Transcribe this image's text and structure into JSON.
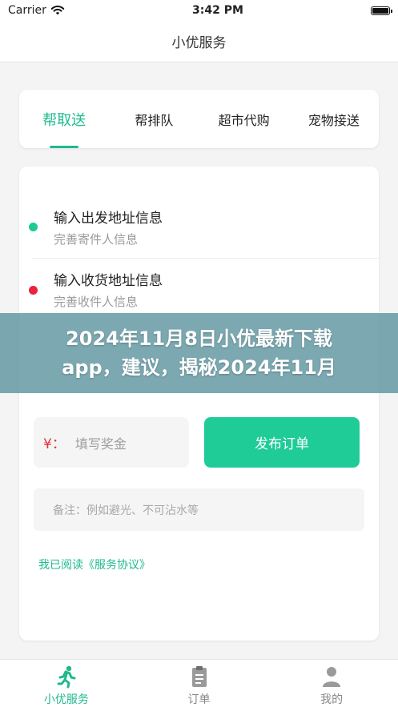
{
  "status_bar": {
    "carrier": "Carrier",
    "time": "3:42 PM"
  },
  "nav": {
    "title": "小优服务"
  },
  "service_tabs": [
    {
      "label": "帮取送",
      "active": true
    },
    {
      "label": "帮排队",
      "active": false
    },
    {
      "label": "超市代购",
      "active": false
    },
    {
      "label": "宠物接送",
      "active": false
    }
  ],
  "pickup": {
    "title": "输入出发地址信息",
    "subtitle": "完善寄件人信息",
    "dot_color": "#1fc996"
  },
  "delivery": {
    "title": "输入收货地址信息",
    "subtitle": "完善收件人信息",
    "dot_color": "#e8233e"
  },
  "reward": {
    "symbol": "¥：",
    "placeholder": "填写奖金"
  },
  "publish_label": "发布订单",
  "remark_placeholder": "备注：例如避光、不可沾水等",
  "agreement_text": "我已阅读《服务协议》",
  "banner": {
    "line1": "2024年11月8日小优最新下载",
    "line2": "app，建议，揭秘2024年11月"
  },
  "bottom_tabs": [
    {
      "label": "小优服务",
      "icon": "runner-icon",
      "active": true
    },
    {
      "label": "订单",
      "icon": "clipboard-icon",
      "active": false
    },
    {
      "label": "我的",
      "icon": "person-icon",
      "active": false
    }
  ],
  "colors": {
    "accent": "#1fba8e",
    "button": "#1fcb96",
    "danger": "#e8233e"
  }
}
